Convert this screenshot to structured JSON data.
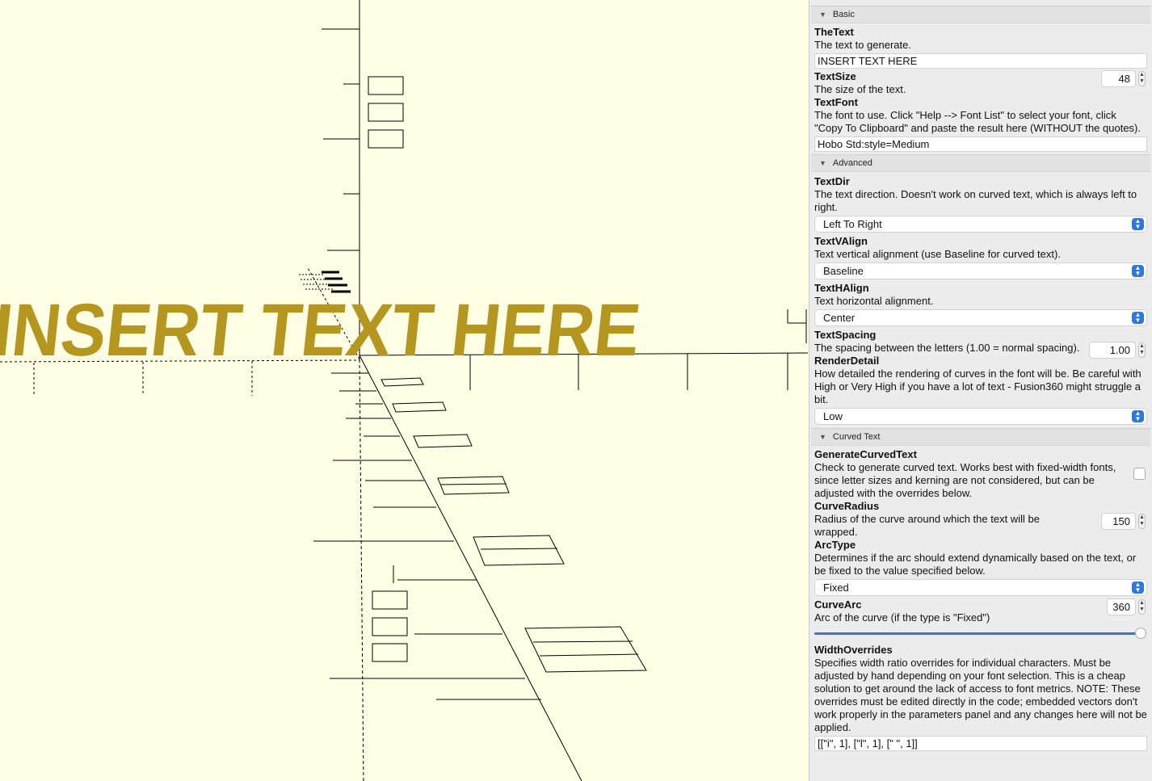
{
  "viewport": {
    "text3d": "INSERT TEXT HERE",
    "text_color": "#b5961f",
    "background": "#ffffe5"
  },
  "panel": {
    "sections": {
      "basic": "Basic",
      "advanced": "Advanced",
      "curved": "Curved Text"
    },
    "params": {
      "thetext": {
        "name": "TheText",
        "desc": "The text to generate.",
        "value": "INSERT TEXT HERE"
      },
      "textsize": {
        "name": "TextSize",
        "desc": "The size of the text.",
        "value": "48"
      },
      "textfont": {
        "name": "TextFont",
        "desc": "The font to use. Click \"Help --> Font List\" to select your font, click \"Copy To Clipboard\" and paste the result here (WITHOUT the quotes).",
        "value": "Hobo Std:style=Medium"
      },
      "textdir": {
        "name": "TextDir",
        "desc": "The text direction. Doesn't work on curved text, which is always left to right.",
        "value": "Left To Right"
      },
      "textvalign": {
        "name": "TextVAlign",
        "desc": "Text vertical alignment (use Baseline for curved text).",
        "value": "Baseline"
      },
      "texthalign": {
        "name": "TextHAlign",
        "desc": "Text horizontal alignment.",
        "value": "Center"
      },
      "textspacing": {
        "name": "TextSpacing",
        "desc": "The spacing between the letters (1.00 = normal spacing).",
        "value": "1.00"
      },
      "renderdetail": {
        "name": "RenderDetail",
        "desc": "How detailed the rendering of curves in the font will be. Be careful with High or Very High if you have a lot of text - Fusion360 might struggle a bit.",
        "value": "Low"
      },
      "generatecurved": {
        "name": "GenerateCurvedText",
        "desc": "Check to generate curved text. Works best with fixed-width fonts, since letter sizes and kerning are not considered, but can be adjusted with the overrides below.",
        "checked": false
      },
      "curveradius": {
        "name": "CurveRadius",
        "desc": "Radius of the curve around which the text will be wrapped.",
        "value": "150"
      },
      "arctype": {
        "name": "ArcType",
        "desc": "Determines if the arc should extend dynamically based on the text, or be fixed to the value specified below.",
        "value": "Fixed"
      },
      "curvearc": {
        "name": "CurveArc",
        "desc": "Arc of the curve (if the type is \"Fixed\")",
        "value": "360",
        "slider_fraction": 1.0
      },
      "widthoverrides": {
        "name": "WidthOverrides",
        "desc": "Specifies width ratio overrides for individual characters. Must be adjusted by hand depending on your font selection. This is a cheap solution to get around the lack of access to font metrics. NOTE: These overrides must be edited directly in the code; embedded vectors don't work properly in the parameters panel and any changes here will not be applied.",
        "value": "[[\"i\", 1], [\"l\", 1], [\" \", 1]]"
      }
    }
  }
}
